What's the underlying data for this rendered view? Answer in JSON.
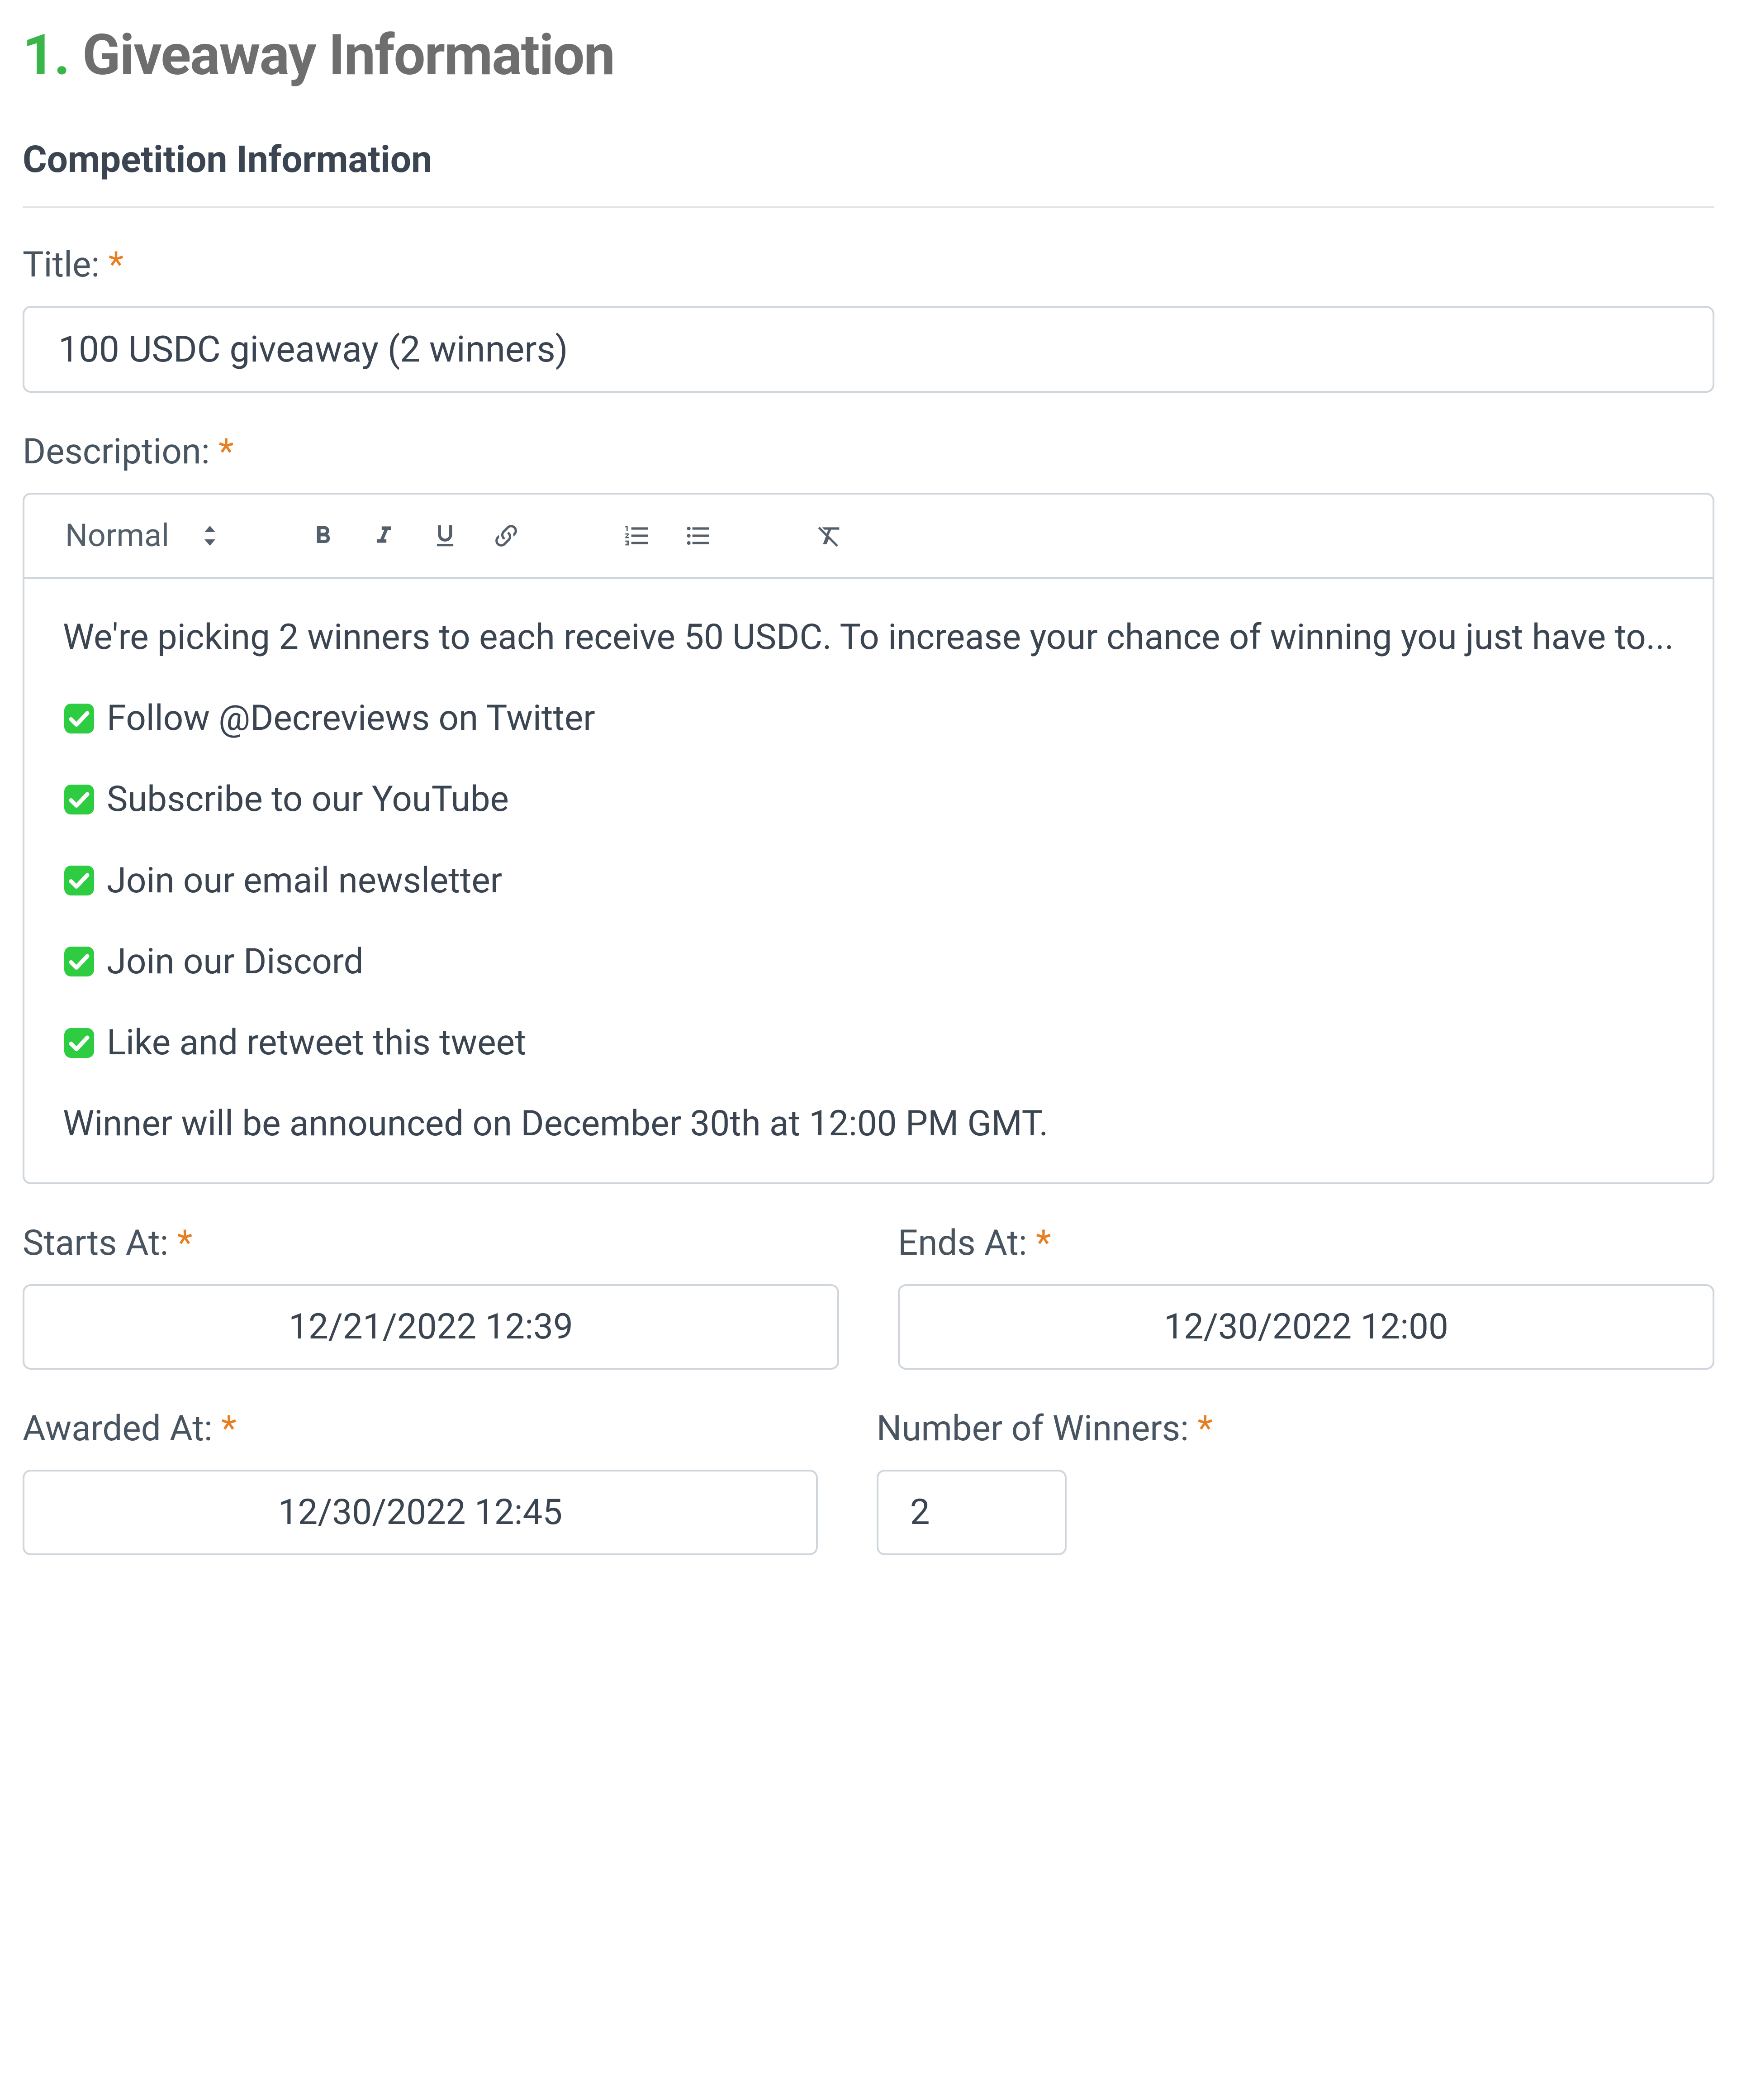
{
  "header": {
    "step_number": "1.",
    "title": "Giveaway Information"
  },
  "section": {
    "title": "Competition Information"
  },
  "fields": {
    "title": {
      "label": "Title:",
      "value": "100 USDC giveaway (2 winners)"
    },
    "description": {
      "label": "Description:",
      "format_selected": "Normal",
      "lines": {
        "intro": "We're picking 2 winners to each receive 50 USDC. To increase your chance of winning you just have to...",
        "item1": "Follow @Decreviews on Twitter",
        "item2": "Subscribe to our YouTube",
        "item3": "Join our email newsletter",
        "item4": "Join our Discord",
        "item5": "Like and retweet this tweet",
        "outro": "Winner will be announced on December 30th at 12:00 PM GMT."
      }
    },
    "starts_at": {
      "label": "Starts At:",
      "value": "12/21/2022 12:39"
    },
    "ends_at": {
      "label": "Ends At:",
      "value": "12/30/2022 12:00"
    },
    "awarded_at": {
      "label": "Awarded At:",
      "value": "12/30/2022 12:45"
    },
    "winners": {
      "label": "Number of Winners:",
      "value": "2"
    }
  }
}
